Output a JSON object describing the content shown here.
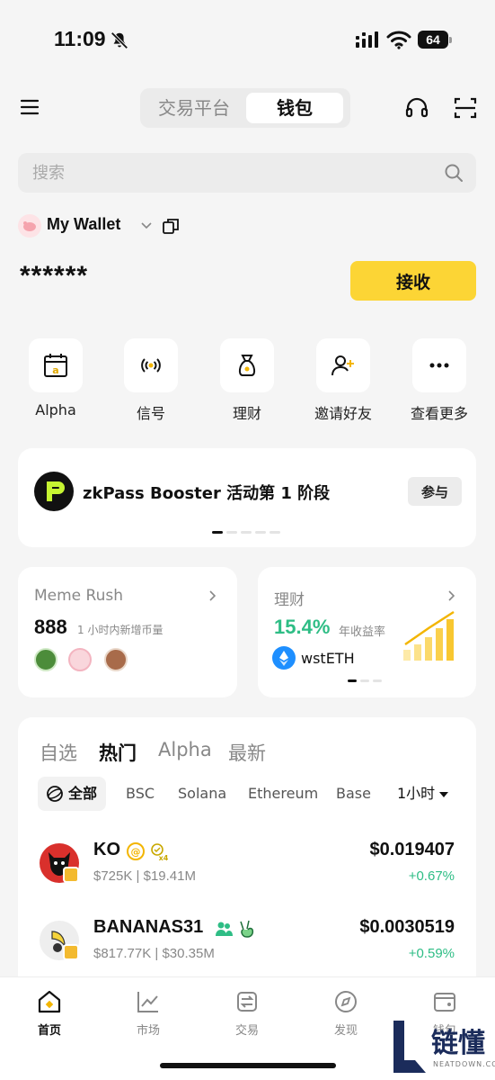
{
  "status_bar": {
    "time": "11:09",
    "battery": "64"
  },
  "top_nav": {
    "tab_exchange": "交易平台",
    "tab_wallet": "钱包"
  },
  "search": {
    "placeholder": "搜索"
  },
  "wallet": {
    "name": "My Wallet",
    "balance": "******",
    "receive_label": "接收"
  },
  "quick_actions": [
    {
      "label": "Alpha",
      "icon": "calendar-a-icon"
    },
    {
      "label": "信号",
      "icon": "signal-broadcast-icon"
    },
    {
      "label": "理财",
      "icon": "money-bag-icon"
    },
    {
      "label": "邀请好友",
      "icon": "add-user-icon"
    },
    {
      "label": "查看更多",
      "icon": "more-dots-icon"
    }
  ],
  "banner": {
    "title": "zkPass Booster 活动第 1 阶段",
    "join_label": "参与"
  },
  "meme_card": {
    "title": "Meme Rush",
    "count": "888",
    "desc": "1 小时内新增币量"
  },
  "earn_card": {
    "title": "理财",
    "apy": "15.4%",
    "apy_label": "年收益率",
    "asset": "wstETH"
  },
  "market": {
    "tabs": [
      "自选",
      "热门",
      "Alpha",
      "最新"
    ],
    "active_tab": "热门",
    "chips": [
      "全部",
      "BSC",
      "Solana",
      "Ethereum",
      "Base"
    ],
    "timeframe": "1小时",
    "rows": [
      {
        "name": "KO",
        "stats": "$725K  |  $19.41M",
        "price": "$0.019407",
        "change": "+0.67%"
      },
      {
        "name": "BANANAS31",
        "stats": "$817.77K  |  $30.35M",
        "price": "$0.0030519",
        "change": "+0.59%"
      }
    ]
  },
  "bottom_nav": [
    "首页",
    "市场",
    "交易",
    "发现",
    "钱包"
  ],
  "watermark": {
    "text": "链懂",
    "sub": "NEATDOWN.COM"
  },
  "colors": {
    "brand": "#fcd535",
    "positive": "#2ebd85",
    "muted": "#888888"
  }
}
